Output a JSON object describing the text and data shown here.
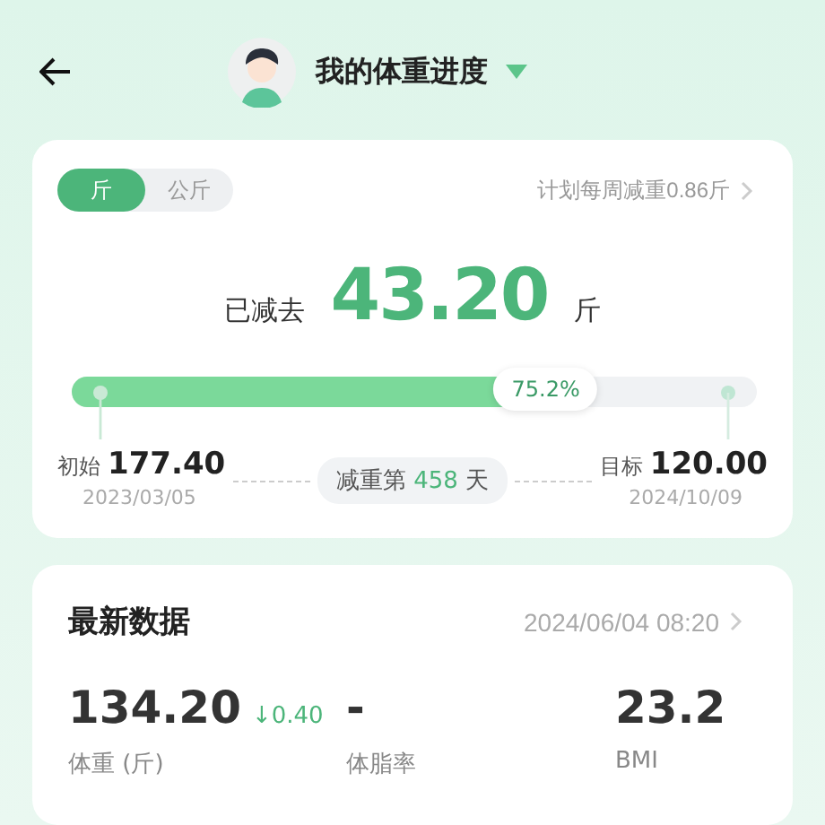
{
  "header": {
    "title": "我的体重进度"
  },
  "progress_card": {
    "units": [
      {
        "label": "斤",
        "selected": true
      },
      {
        "label": "公斤",
        "selected": false
      }
    ],
    "plan": "计划每周减重0.86斤",
    "lost_label": "已减去",
    "lost_value": "43.20",
    "lost_unit": "斤",
    "progress": {
      "level": 0.752,
      "reading": "75.2%"
    },
    "start": {
      "label": "初始",
      "value": "177.40",
      "date": "2023/03/05"
    },
    "days": {
      "prefix": "减重第",
      "count": "458",
      "suffix": "天"
    },
    "goal": {
      "label": "目标",
      "value": "120.00",
      "date": "2024/10/09"
    }
  },
  "latest_card": {
    "title": "最新数据",
    "time": "2024/06/04 08:20",
    "metrics": [
      {
        "value": "134.20",
        "change": "↓0.40",
        "label": "体重 (斤)"
      },
      {
        "value": "-",
        "label": "体脂率"
      },
      {
        "value": "23.2",
        "label": "BMI"
      }
    ]
  }
}
